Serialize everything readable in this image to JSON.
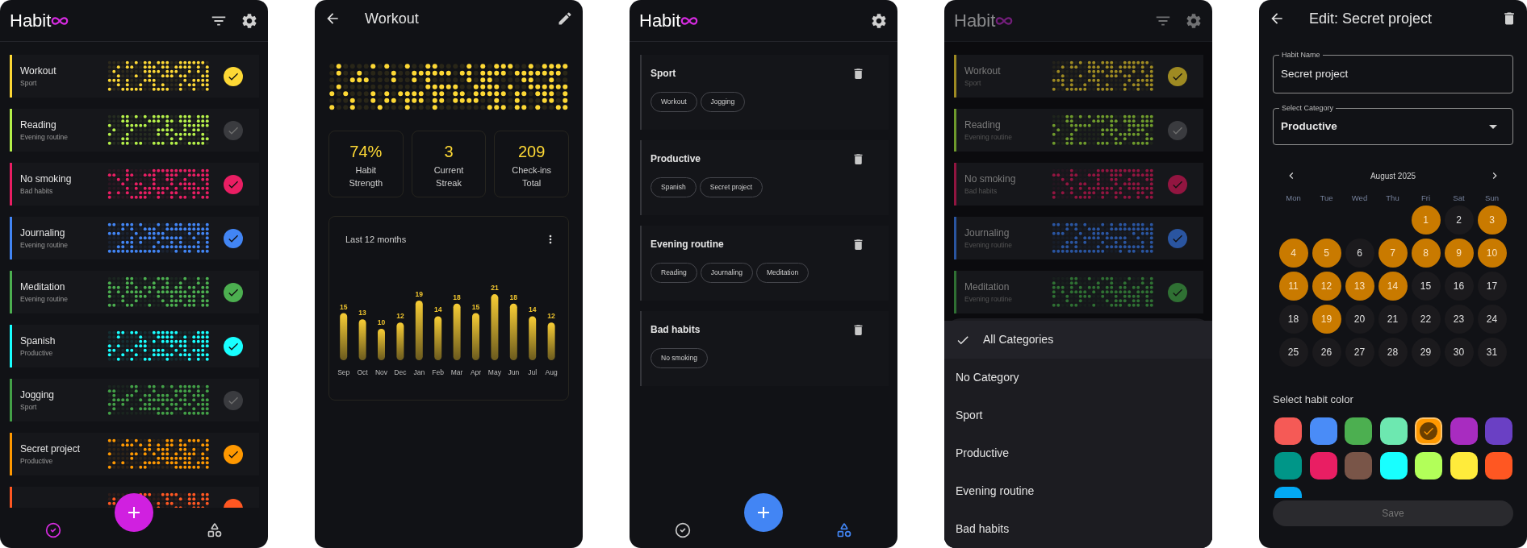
{
  "habit_list": {
    "logo": "Habit",
    "habits": [
      {
        "name": "Workout",
        "category": "Sport",
        "color": "#fdd835",
        "checked": true
      },
      {
        "name": "Reading",
        "category": "Evening routine",
        "color": "#b5f04a",
        "checked": false
      },
      {
        "name": "No smoking",
        "category": "Bad habits",
        "color": "#e91e63",
        "checked": true
      },
      {
        "name": "Journaling",
        "category": "Evening routine",
        "color": "#4285f4",
        "checked": true
      },
      {
        "name": "Meditation",
        "category": "Evening routine",
        "color": "#4caf50",
        "checked": true
      },
      {
        "name": "Spanish",
        "category": "Productive",
        "color": "#18ffff",
        "checked": true
      },
      {
        "name": "Jogging",
        "category": "Sport",
        "color": "#43a047",
        "checked": false
      },
      {
        "name": "Secret project",
        "category": "Productive",
        "color": "#ff9800",
        "checked": true
      },
      {
        "color": "#ff5722",
        "checked": true
      }
    ],
    "nav": [
      {
        "selected": true
      },
      {
        "selected": false
      }
    ]
  },
  "habit_detail": {
    "title": "Workout",
    "stats": [
      {
        "value": "74%",
        "label": "Habit Strength"
      },
      {
        "value": "3",
        "label": "Current Streak"
      },
      {
        "value": "209",
        "label": "Check-ins Total"
      }
    ],
    "chart_data": {
      "type": "bar",
      "title": "Last 12 months",
      "categories": [
        "Sep",
        "Oct",
        "Nov",
        "Dec",
        "Jan",
        "Feb",
        "Mar",
        "Apr",
        "May",
        "Jun",
        "Jul",
        "Aug"
      ],
      "values": [
        15,
        13,
        10,
        12,
        19,
        14,
        18,
        15,
        21,
        18,
        14,
        12
      ],
      "data_labels": true
    }
  },
  "categories_screen": {
    "logo": "Habit",
    "categories": [
      {
        "name": "Sport",
        "habits": [
          "Workout",
          "Jogging"
        ]
      },
      {
        "name": "Productive",
        "habits": [
          "Spanish",
          "Secret project"
        ]
      },
      {
        "name": "Evening routine",
        "habits": [
          "Reading",
          "Journaling",
          "Meditation"
        ]
      },
      {
        "name": "Bad habits",
        "habits": [
          "No smoking"
        ]
      }
    ],
    "nav": [
      {
        "selected": false
      },
      {
        "selected": true
      }
    ]
  },
  "filter_screen": {
    "logo": "Habit",
    "habits": [
      {
        "name": "Workout",
        "category": "Sport",
        "color": "#9e8a22",
        "checked": true
      },
      {
        "name": "Reading",
        "category": "Evening routine",
        "color": "#6e9a2c",
        "checked": false
      },
      {
        "name": "No smoking",
        "category": "Bad habits",
        "color": "#921540",
        "checked": true
      },
      {
        "name": "Journaling",
        "category": "Evening routine",
        "color": "#2a55a0",
        "checked": true
      },
      {
        "name": "Meditation",
        "category": "Evening routine",
        "color": "#2f7033",
        "checked": true
      }
    ],
    "menu": [
      {
        "label": "All Categories",
        "selected": true
      },
      {
        "label": "No Category",
        "selected": false
      },
      {
        "label": "Sport",
        "selected": false
      },
      {
        "label": "Productive",
        "selected": false
      },
      {
        "label": "Evening routine",
        "selected": false
      },
      {
        "label": "Bad habits",
        "selected": false
      }
    ]
  },
  "edit_screen": {
    "title": "Edit: Secret project",
    "name_field": {
      "label": "Habit Name",
      "value": "Secret project"
    },
    "category_field": {
      "label": "Select Category",
      "value": "Productive"
    },
    "calendar": {
      "month": "August 2025",
      "weekdays": [
        "Mon",
        "Tue",
        "Wed",
        "Thu",
        "Fri",
        "Sat",
        "Sun"
      ],
      "weeks": [
        {
          "days": [
            {
              "label": "1",
              "selected": true
            },
            {
              "label": "2",
              "selected": false
            },
            {
              "label": "3",
              "selected": true
            }
          ]
        },
        {
          "days": [
            {
              "label": "4",
              "selected": true
            },
            {
              "label": "5",
              "selected": true
            },
            {
              "label": "6",
              "selected": false
            },
            {
              "label": "7",
              "selected": true
            },
            {
              "label": "8",
              "selected": true
            },
            {
              "label": "9",
              "selected": true
            },
            {
              "label": "10",
              "selected": true
            }
          ]
        },
        {
          "days": [
            {
              "label": "11",
              "selected": true
            },
            {
              "label": "12",
              "selected": true
            },
            {
              "label": "13",
              "selected": true
            },
            {
              "label": "14",
              "selected": true
            },
            {
              "label": "15",
              "selected": false
            },
            {
              "label": "16",
              "selected": false
            },
            {
              "label": "17",
              "selected": false
            }
          ]
        },
        {
          "days": [
            {
              "label": "18",
              "selected": false
            },
            {
              "label": "19",
              "selected": true
            },
            {
              "label": "20",
              "selected": false
            },
            {
              "label": "21",
              "selected": false
            },
            {
              "label": "22",
              "selected": false
            },
            {
              "label": "23",
              "selected": false
            },
            {
              "label": "24",
              "selected": false
            }
          ]
        },
        {
          "days": [
            {
              "label": "25",
              "selected": false
            },
            {
              "label": "26",
              "selected": false
            },
            {
              "label": "27",
              "selected": false
            },
            {
              "label": "28",
              "selected": false
            },
            {
              "label": "29",
              "selected": false
            },
            {
              "label": "30",
              "selected": false
            },
            {
              "label": "31",
              "selected": false
            }
          ]
        }
      ]
    },
    "color_label": "Select habit color",
    "swatches": [
      {
        "color": "#f55a56",
        "selected": false
      },
      {
        "color": "#4a8cf7",
        "selected": false
      },
      {
        "color": "#4caf50",
        "selected": false
      },
      {
        "color": "#6de8b0",
        "selected": false
      },
      {
        "color": "#ff9800",
        "selected": true
      },
      {
        "color": "#a82cc0",
        "selected": false
      },
      {
        "color": "#6a40c4",
        "selected": false
      },
      {
        "color": "#009688",
        "selected": false
      },
      {
        "color": "#e91e63",
        "selected": false
      },
      {
        "color": "#795548",
        "selected": false
      },
      {
        "color": "#18ffff",
        "selected": false
      },
      {
        "color": "#b2ff59",
        "selected": false
      },
      {
        "color": "#ffeb3b",
        "selected": false
      },
      {
        "color": "#ff5722",
        "selected": false
      },
      {
        "color": "#03a9f4",
        "selected": false
      }
    ],
    "save_button": {
      "label": "Save",
      "disabled": true
    }
  }
}
